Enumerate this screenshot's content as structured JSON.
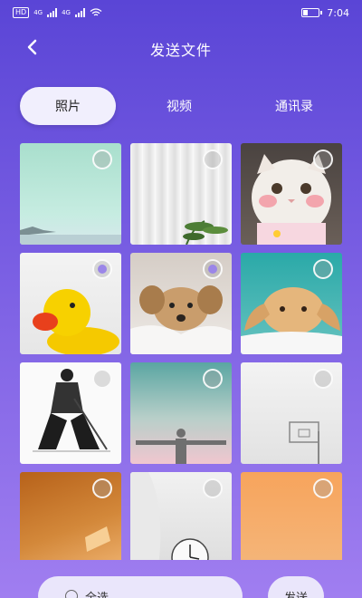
{
  "status": {
    "hd": "HD",
    "net1": "4G",
    "net2": "4G",
    "battery_level": 0.3,
    "time": "7:04"
  },
  "header": {
    "title": "发送文件"
  },
  "tabs": [
    {
      "label": "照片",
      "active": true
    },
    {
      "label": "视频",
      "active": false
    },
    {
      "label": "通讯录",
      "active": false
    }
  ],
  "photos": [
    {
      "name": "beach",
      "selected": false
    },
    {
      "name": "curtain",
      "selected": false
    },
    {
      "name": "white-cat",
      "selected": false
    },
    {
      "name": "rubber-duck",
      "selected": true
    },
    {
      "name": "puppy",
      "selected": true
    },
    {
      "name": "rabbit",
      "selected": false
    },
    {
      "name": "samurai-sketch",
      "selected": false
    },
    {
      "name": "christ-statue",
      "selected": false
    },
    {
      "name": "basketball-hoop",
      "selected": false
    },
    {
      "name": "sunset-wall",
      "selected": false
    },
    {
      "name": "clock",
      "selected": false
    },
    {
      "name": "orange-gradient",
      "selected": false
    }
  ],
  "bottom": {
    "select_all_label": "全选",
    "send_label": "发送"
  },
  "colors": {
    "accent": "#5a45d6",
    "tab_active_bg": "#f1effd"
  }
}
